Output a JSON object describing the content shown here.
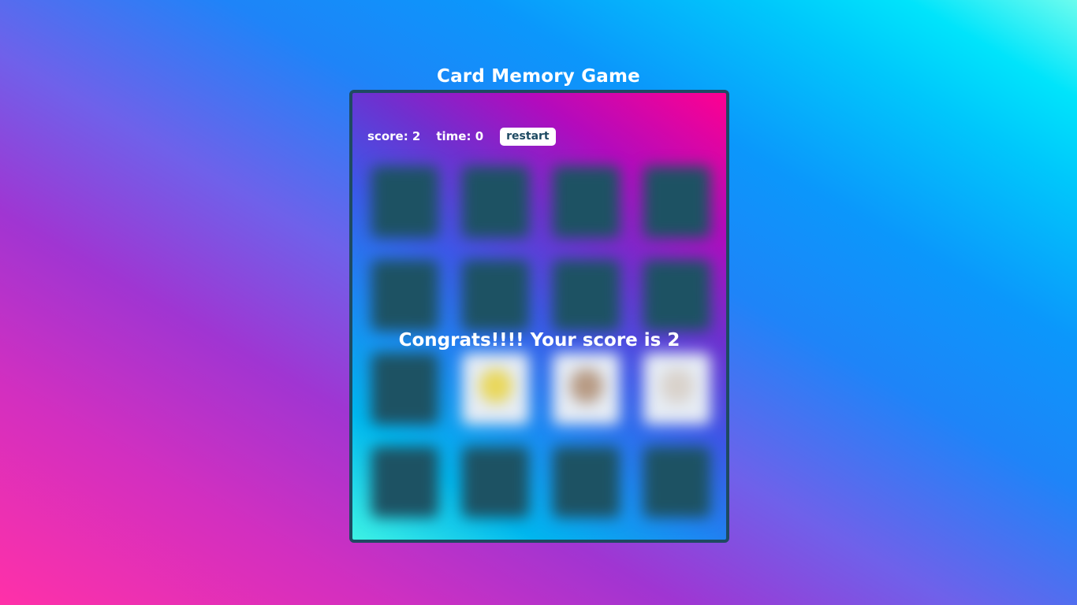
{
  "page": {
    "title": "Card Memory Game"
  },
  "hud": {
    "score_label": "score: 2",
    "time_label": "time: 0",
    "restart_label": "restart"
  },
  "game": {
    "score": 2,
    "time": 0,
    "rows": 4,
    "columns": 4,
    "revealed_cards": [
      {
        "row": 3,
        "col": 2,
        "picture_color": "#e9d75a"
      },
      {
        "row": 3,
        "col": 3,
        "picture_color": "#b79a83"
      },
      {
        "row": 3,
        "col": 4,
        "picture_color": "#d9d2cb"
      }
    ]
  },
  "message": {
    "text": "Congrats!!!! Your score is 2"
  },
  "colors": {
    "card_back": "#1d5263",
    "board_border": "#1e4a62",
    "text": "#ffffff"
  }
}
